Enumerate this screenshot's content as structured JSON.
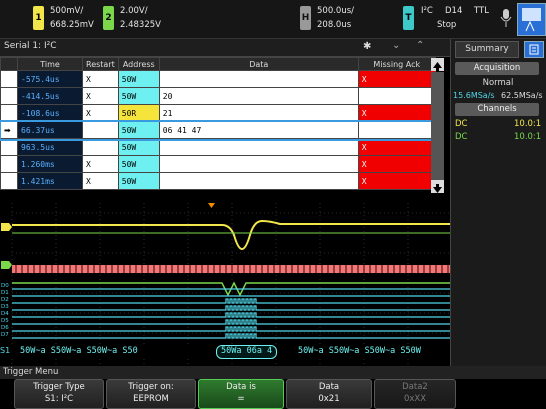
{
  "topbar": {
    "ch1": {
      "label": "1",
      "scale": "500mV/",
      "offset": "668.25mV",
      "color": "#f2e64a"
    },
    "ch2": {
      "label": "2",
      "scale": "2.00V/",
      "offset": "2.48325V",
      "color": "#7ad84a"
    },
    "horizontal": {
      "label": "H",
      "scale": "500.0us/",
      "delay": "208.0us"
    },
    "trigger": {
      "label": "T",
      "type": "I²C",
      "source": "D14",
      "level": "TTL",
      "mode": "Stop"
    }
  },
  "serial": {
    "title": "Serial 1: I²C",
    "columns": [
      "Time",
      "Restart",
      "Address",
      "Data",
      "Missing Ack"
    ],
    "rows": [
      {
        "marker": "",
        "time": "-575.4us",
        "restart": "X",
        "address": "50W",
        "data": "",
        "missing": "X",
        "addr_kind": "w"
      },
      {
        "marker": "",
        "time": "-414.5us",
        "restart": "X",
        "address": "50W",
        "data": "20",
        "missing": "",
        "addr_kind": "w"
      },
      {
        "marker": "",
        "time": "-108.6us",
        "restart": "X",
        "address": "50R",
        "data": "21",
        "missing": "X",
        "addr_kind": "r"
      },
      {
        "marker": "➡",
        "time": "66.37us",
        "restart": "",
        "address": "50W",
        "data": "06 41 47",
        "missing": "",
        "addr_kind": "w"
      },
      {
        "marker": "",
        "time": "963.5us",
        "restart": "",
        "address": "50W",
        "data": "",
        "missing": "X",
        "addr_kind": "w"
      },
      {
        "marker": "",
        "time": "1.260ms",
        "restart": "X",
        "address": "50W",
        "data": "",
        "missing": "X",
        "addr_kind": "w"
      },
      {
        "marker": "",
        "time": "1.421ms",
        "restart": "X",
        "address": "50W",
        "data": "",
        "missing": "X",
        "addr_kind": "w"
      }
    ]
  },
  "right_panel": {
    "tab": "Summary",
    "acquisition_header": "Acquisition",
    "acq_mode": "Normal",
    "sample_rate_1": "15.6MSa/s",
    "sample_rate_2": "62.5MSa/s",
    "channels_header": "Channels",
    "ch1_coupling": "DC",
    "ch1_probe": "10.0:1",
    "ch2_coupling": "DC",
    "ch2_probe": "10.0:1"
  },
  "decode_bus": {
    "label": "S1",
    "left_segments": [
      "50W~a",
      "S50W~a",
      "S50W~a",
      "S50"
    ],
    "center": "50Wa 06a 4",
    "right_segments": [
      "50W~a",
      "S50W~a",
      "S50W~a",
      "S50W"
    ]
  },
  "digital_labels": [
    "D0",
    "D1",
    "D2",
    "D3",
    "D4",
    "D5",
    "D6",
    "D7"
  ],
  "menu": {
    "title": "Trigger Menu",
    "softkeys": [
      {
        "line1": "Trigger Type",
        "line2": "S1: I²C"
      },
      {
        "line1": "Trigger on:",
        "line2": "EEPROM"
      },
      {
        "line1": "Data is",
        "line2": "="
      },
      {
        "line1": "Data",
        "line2": "0x21"
      },
      {
        "line1": "Data2",
        "line2": "0xXX"
      }
    ]
  },
  "colors": {
    "ch1": "#f2e64a",
    "ch2": "#7ad84a",
    "digital": "#4fd7e8",
    "decode": "#6ef0f0",
    "error": "#f00000"
  }
}
